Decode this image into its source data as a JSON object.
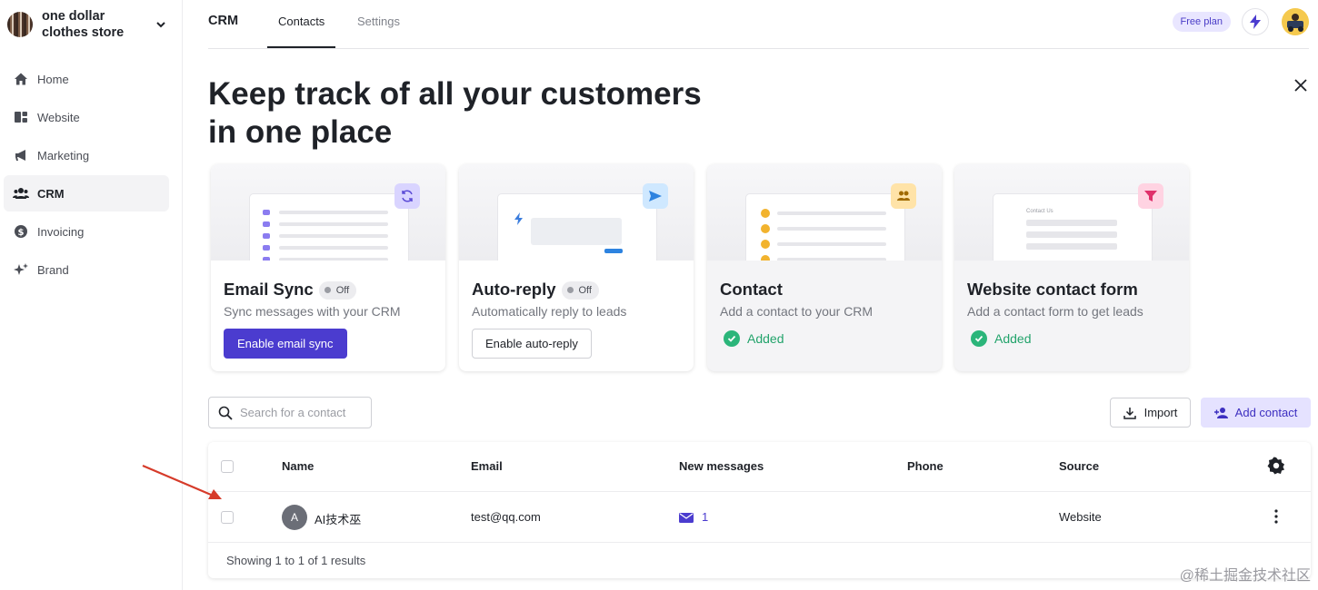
{
  "store": {
    "name": "one dollar clothes store"
  },
  "sidebar": {
    "items": [
      {
        "label": "Home",
        "icon": "home-icon"
      },
      {
        "label": "Website",
        "icon": "website-icon"
      },
      {
        "label": "Marketing",
        "icon": "megaphone-icon"
      },
      {
        "label": "CRM",
        "icon": "users-icon",
        "active": true
      },
      {
        "label": "Invoicing",
        "icon": "dollar-icon"
      },
      {
        "label": "Brand",
        "icon": "sparkle-icon"
      }
    ]
  },
  "topbar": {
    "title": "CRM",
    "tabs": [
      {
        "label": "Contacts",
        "active": true
      },
      {
        "label": "Settings"
      }
    ],
    "plan_badge": "Free plan"
  },
  "hero": {
    "line1": "Keep track of all your customers",
    "line2": "in one place"
  },
  "cards": [
    {
      "title": "Email Sync",
      "toggle": "Off",
      "desc": "Sync messages with your CRM",
      "button": "Enable email sync",
      "icon": "sync-icon",
      "accent": "#d9d4ff"
    },
    {
      "title": "Auto-reply",
      "toggle": "Off",
      "desc": "Automatically reply to leads",
      "button": "Enable auto-reply",
      "icon": "send-icon",
      "accent": "#cfe8ff"
    },
    {
      "title": "Contact",
      "desc": "Add a contact to your CRM",
      "status": "Added",
      "icon": "contacts-icon",
      "accent": "#ffe3a8"
    },
    {
      "title": "Website contact form",
      "desc": "Add a contact form to get leads",
      "status": "Added",
      "icon": "funnel-icon",
      "accent": "#ffd3e2",
      "mock_label": "Contact Us"
    }
  ],
  "search": {
    "placeholder": "Search for a contact"
  },
  "actions": {
    "import": "Import",
    "add_contact": "Add contact"
  },
  "table": {
    "columns": [
      "Name",
      "Email",
      "New messages",
      "Phone",
      "Source"
    ],
    "rows": [
      {
        "initial": "A",
        "name": "AI技术巫",
        "email": "test@qq.com",
        "new_messages": "1",
        "phone": "",
        "source": "Website"
      }
    ],
    "footer": "Showing 1 to 1 of 1 results"
  },
  "watermark": "@稀土掘金技术社区",
  "colors": {
    "primary": "#4b3ccf",
    "success": "#2bb57a",
    "arrow": "#d63b2a"
  }
}
